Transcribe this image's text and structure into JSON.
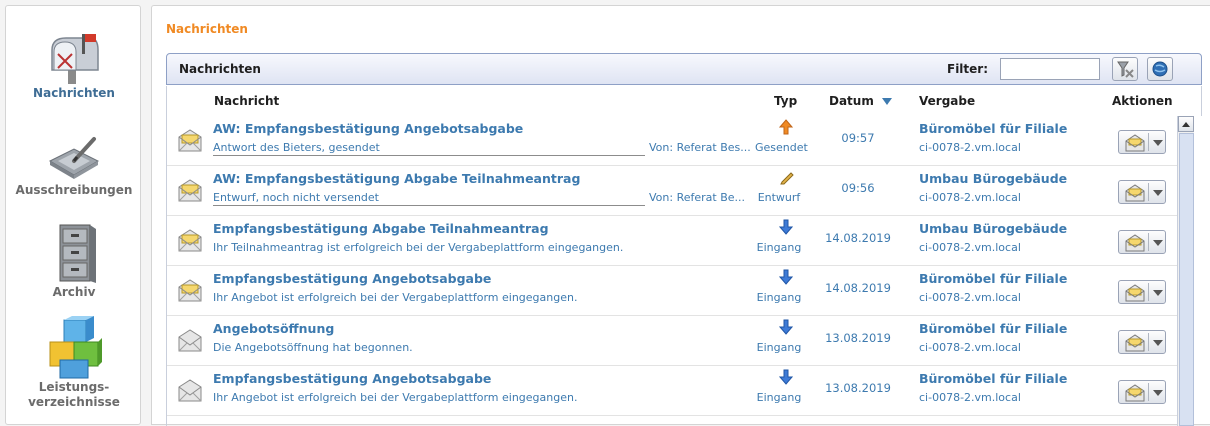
{
  "sidebar": {
    "items": [
      {
        "label": "Nachrichten",
        "icon": "mailbox-icon"
      },
      {
        "label": "Ausschreibungen",
        "icon": "tablet-pen-icon"
      },
      {
        "label": "Archiv",
        "icon": "filing-cabinet-icon"
      },
      {
        "label": "Leistungs-",
        "label2": "verzeichnisse",
        "icon": "cubes-icon"
      }
    ]
  },
  "page": {
    "title": "Nachrichten"
  },
  "panel": {
    "title": "Nachrichten",
    "filter_label": "Filter:",
    "filter_value": ""
  },
  "columns": {
    "nachricht": "Nachricht",
    "typ": "Typ",
    "datum": "Datum",
    "vergabe": "Vergabe",
    "aktionen": "Aktionen"
  },
  "messages": [
    {
      "subject": "AW: Empfangsbestätigung Angebotsabgabe",
      "sub": "Antwort des Bieters, gesendet",
      "from": "Von: Referat Bes...",
      "type": "Gesendet",
      "type_icon": "arrow-up-icon",
      "date": "09:57",
      "vergabe": "Büromöbel für Filiale",
      "host": "ci-0078-2.vm.local"
    },
    {
      "subject": "AW: Empfangsbestätigung Abgabe Teilnahmeantrag",
      "sub": "Entwurf, noch nicht versendet",
      "from": "Von: Referat Be...",
      "type": "Entwurf",
      "type_icon": "pencil-icon",
      "date": "09:56",
      "vergabe": "Umbau Bürogebäude",
      "host": "ci-0078-2.vm.local"
    },
    {
      "subject": "Empfangsbestätigung Abgabe Teilnahmeantrag",
      "sub": "Ihr Teilnahmeantrag ist erfolgreich bei der Vergabeplattform eingegangen.",
      "from": "",
      "type": "Eingang",
      "type_icon": "arrow-down-icon",
      "date": "14.08.2019",
      "vergabe": "Umbau Bürogebäude",
      "host": "ci-0078-2.vm.local"
    },
    {
      "subject": "Empfangsbestätigung Angebotsabgabe",
      "sub": "Ihr Angebot ist erfolgreich bei der Vergabeplattform eingegangen.",
      "from": "",
      "type": "Eingang",
      "type_icon": "arrow-down-icon",
      "date": "14.08.2019",
      "vergabe": "Büromöbel für Filiale",
      "host": "ci-0078-2.vm.local"
    },
    {
      "subject": "Angebotsöffnung",
      "sub": "Die Angebotsöffnung hat begonnen.",
      "from": "",
      "type": "Eingang",
      "type_icon": "arrow-down-icon",
      "date": "13.08.2019",
      "vergabe": "Büromöbel für Filiale",
      "host": "ci-0078-2.vm.local"
    },
    {
      "subject": "Empfangsbestätigung Angebotsabgabe",
      "sub": "Ihr Angebot ist erfolgreich bei der Vergabeplattform eingegangen.",
      "from": "",
      "type": "Eingang",
      "type_icon": "arrow-down-icon",
      "date": "13.08.2019",
      "vergabe": "Büromöbel für Filiale",
      "host": "ci-0078-2.vm.local"
    }
  ],
  "colors": {
    "accent": "#3d7aaf",
    "title_orange": "#f08a24",
    "header_border": "#8ea0c6"
  }
}
